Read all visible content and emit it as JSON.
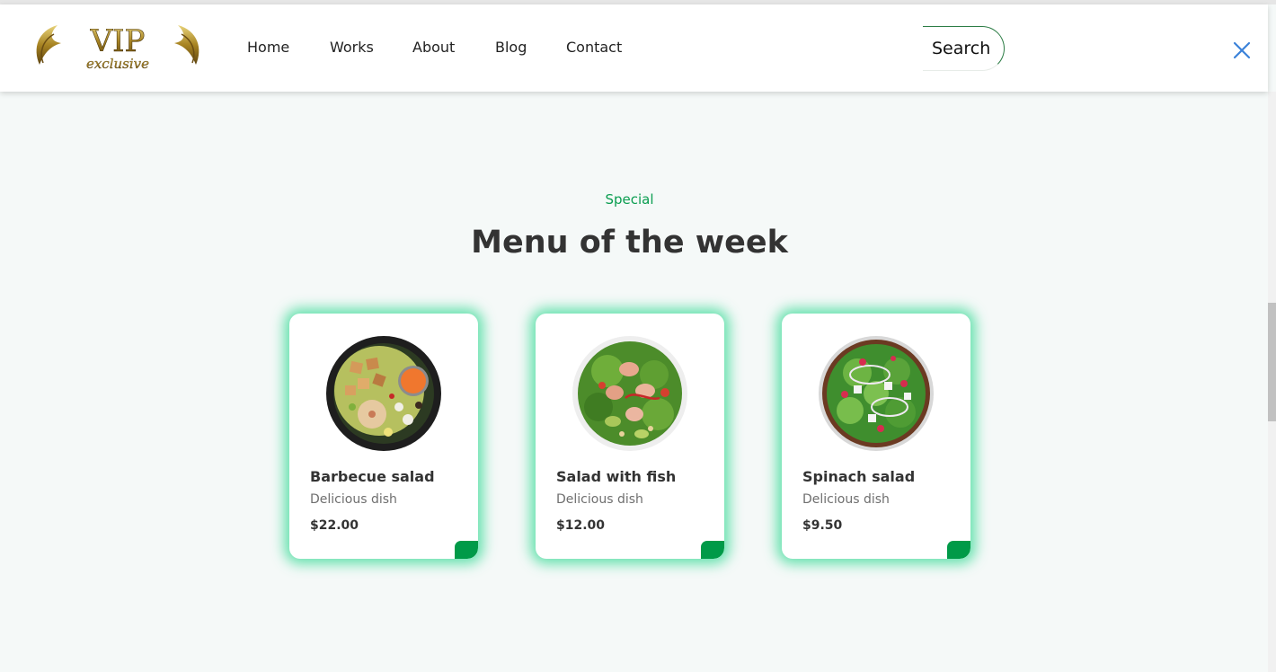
{
  "brand": {
    "logo_main": "VIP",
    "logo_sub": "exclusive"
  },
  "nav": {
    "items": [
      "Home",
      "Works",
      "About",
      "Blog",
      "Contact"
    ]
  },
  "search": {
    "label": "Search"
  },
  "colors": {
    "accent": "#0a9d50",
    "card_glow": "#38d995",
    "cart_button": "#009a48",
    "close_icon": "#3b82d9"
  },
  "section": {
    "subtitle": "Special",
    "title": "Menu of the week"
  },
  "menu": [
    {
      "name": "Barbecue salad",
      "description": "Delicious dish",
      "price": "$22.00",
      "icon": "barbecue-salad-bowl"
    },
    {
      "name": "Salad with fish",
      "description": "Delicious dish",
      "price": "$12.00",
      "icon": "fish-salad-bowl"
    },
    {
      "name": "Spinach salad",
      "description": "Delicious dish",
      "price": "$9.50",
      "icon": "spinach-salad-bowl"
    }
  ]
}
